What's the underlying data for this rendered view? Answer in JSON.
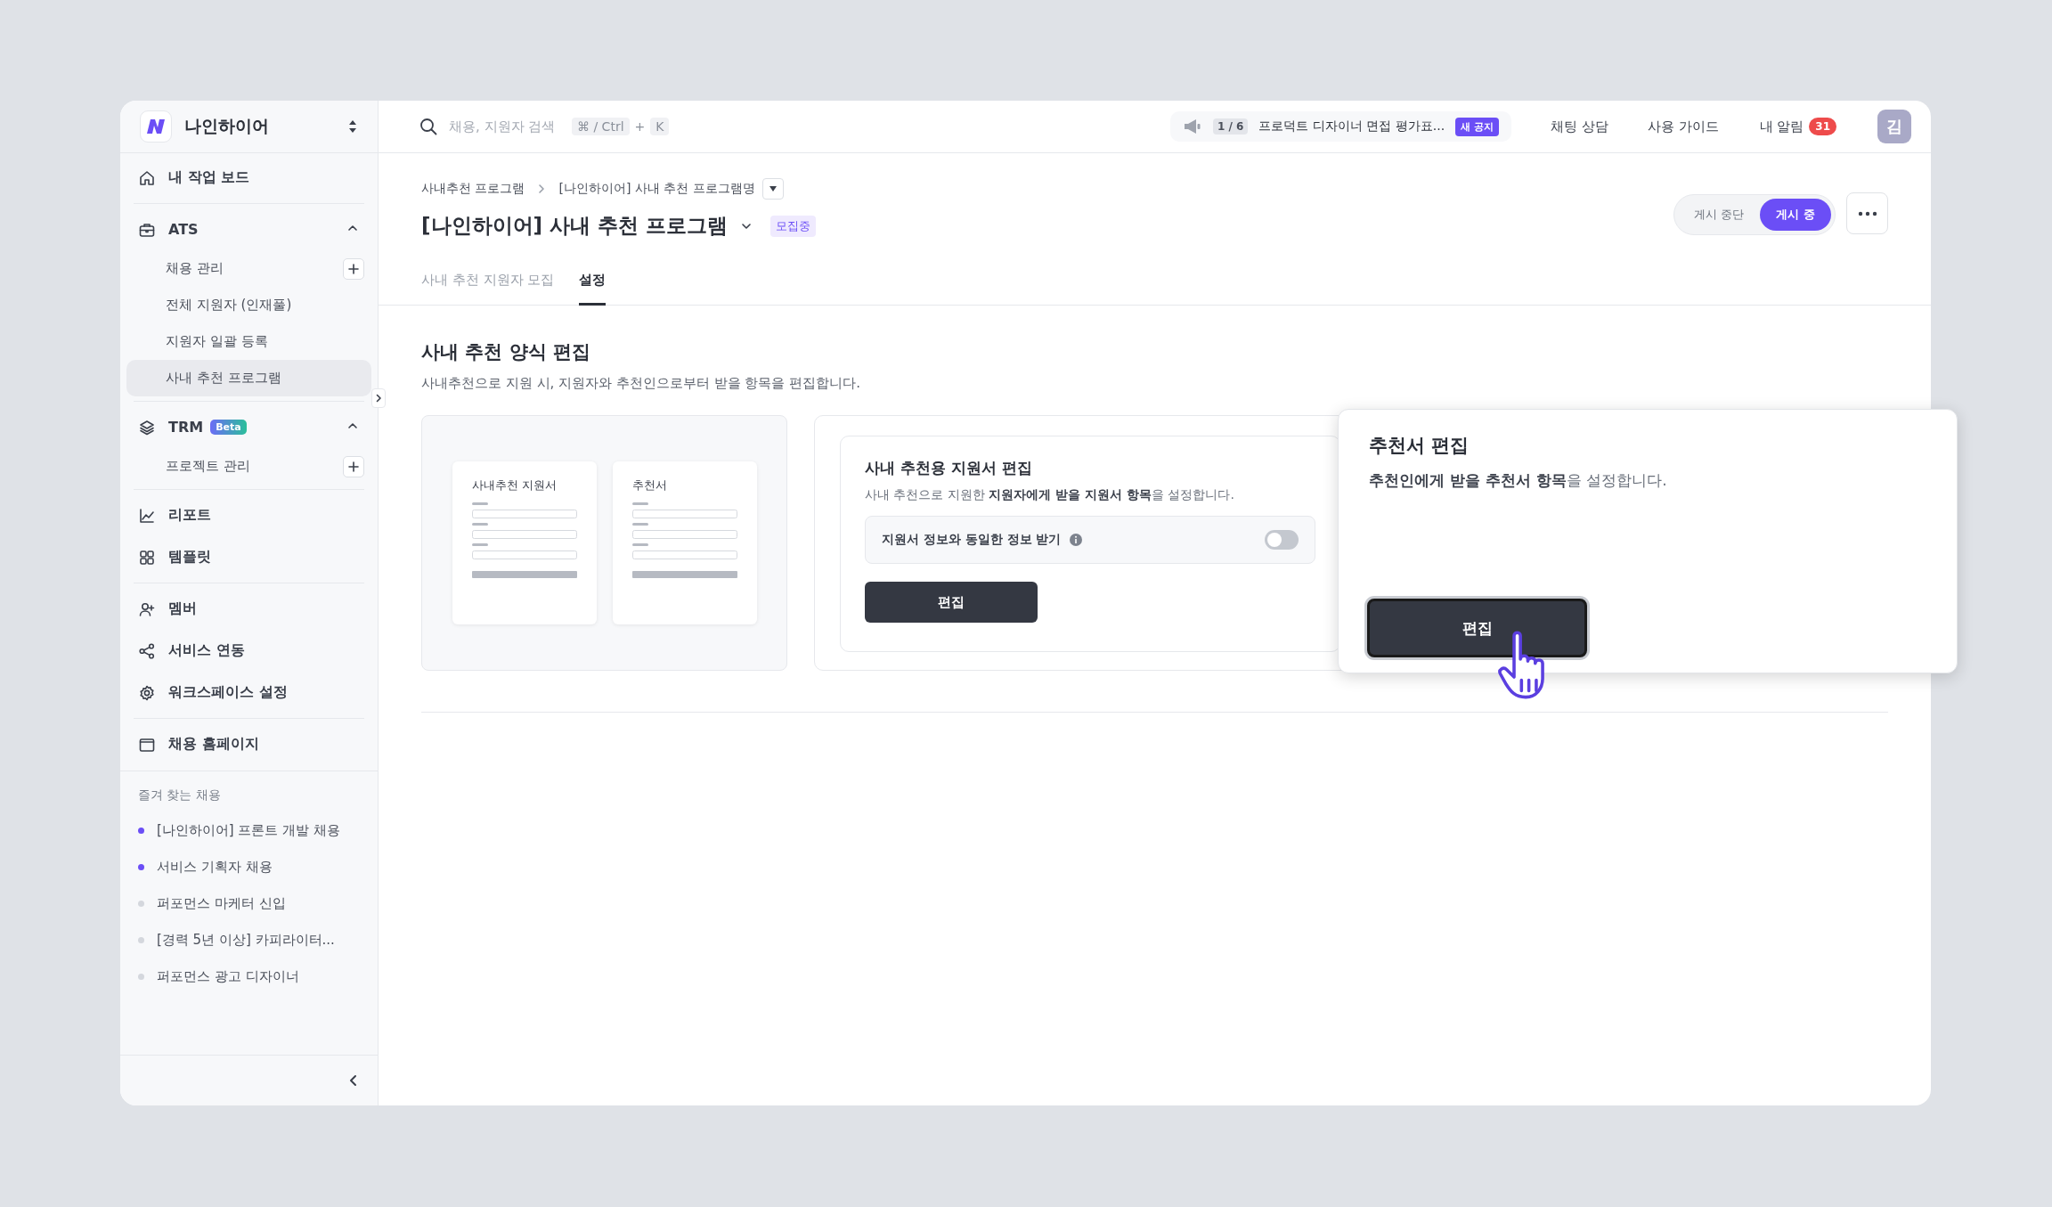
{
  "workspace": {
    "name": "나인하이어"
  },
  "sidebar": {
    "sections": [
      [
        {
          "kind": "link",
          "label": "내 작업 보드"
        }
      ],
      [
        {
          "kind": "group",
          "label": "ATS",
          "expanded": true,
          "children": [
            {
              "label": "채용 관리",
              "addable": true,
              "selected": false
            },
            {
              "label": "전체 지원자 (인재풀)",
              "addable": false,
              "selected": false
            },
            {
              "label": "지원자 일괄 등록",
              "addable": false,
              "selected": false
            },
            {
              "label": "사내 추천 프로그램",
              "addable": false,
              "selected": true
            }
          ]
        }
      ],
      [
        {
          "kind": "group",
          "label": "TRM",
          "badge": "Beta",
          "expanded": true,
          "children": [
            {
              "label": "프로젝트 관리",
              "addable": true,
              "selected": false
            }
          ]
        }
      ],
      [
        {
          "kind": "link",
          "label": "리포트"
        },
        {
          "kind": "link",
          "label": "템플릿"
        }
      ],
      [
        {
          "kind": "link",
          "label": "멤버"
        },
        {
          "kind": "link",
          "label": "서비스 연동"
        },
        {
          "kind": "link",
          "label": "워크스페이스 설정"
        }
      ],
      [
        {
          "kind": "link",
          "label": "채용 홈페이지"
        }
      ]
    ],
    "favorites": {
      "title": "즐겨 찾는 채용",
      "items": [
        {
          "label": "[나인하이어] 프론트 개발 채용",
          "color": "#6b4ef6"
        },
        {
          "label": "서비스 기획자 채용",
          "color": "#6b4ef6"
        },
        {
          "label": "퍼포먼스 마케터 신입",
          "color": "#d4d7dd"
        },
        {
          "label": "[경력 5년 이상] 카피라이터...",
          "color": "#d4d7dd"
        },
        {
          "label": "퍼포먼스 광고 디자이너",
          "color": "#d4d7dd"
        }
      ]
    }
  },
  "topbar": {
    "search": {
      "placeholder": "채용, 지원자 검색",
      "shortcut": [
        {
          "kind": "key",
          "text": "⌘ / Ctrl"
        },
        {
          "kind": "sep",
          "text": "+"
        },
        {
          "kind": "key",
          "text": "K"
        }
      ]
    },
    "notice": {
      "counter": "1 / 6",
      "text": "프로덕트 디자이너 면접 평가표...",
      "badge": "새 공지"
    },
    "links": [
      "채팅 상담",
      "사용 가이드"
    ],
    "notifications": {
      "label": "내 알림",
      "count": "31"
    },
    "avatar": {
      "initial": "김"
    }
  },
  "header": {
    "breadcrumb": [
      "사내추천 프로그램",
      "[나인하이어] 사내 추천 프로그램명"
    ],
    "title": "[나인하이어] 사내 추천 프로그램",
    "status": "모집중",
    "publish": [
      {
        "label": "게시 중단",
        "selected": false
      },
      {
        "label": "게시 중",
        "selected": true
      }
    ],
    "tabs": [
      {
        "label": "사내 추천 지원자 모집",
        "selected": false
      },
      {
        "label": "설정",
        "selected": true
      }
    ]
  },
  "section": {
    "title": "사내 추천 양식 편집",
    "description": "사내추천으로 지원 시, 지원자와 추천인으로부터 받을 항목을 편집합니다."
  },
  "preview": {
    "documents": [
      {
        "title": "사내추천 지원서"
      },
      {
        "title": "추천서"
      }
    ]
  },
  "application_card": {
    "title": "사내 추천용 지원서 편집",
    "description": "사내 추천으로 지원한 **지원자에게 받을 지원서 항목**을 설정합니다.",
    "option": {
      "label": "지원서 정보와 동일한 정보 받기",
      "on": false
    },
    "button": "편집"
  },
  "popover": {
    "title": "추천서 편집",
    "description": "**추천인에게 받을 추천서 항목**을 설정합니다.",
    "button": "편집",
    "focused": true
  }
}
